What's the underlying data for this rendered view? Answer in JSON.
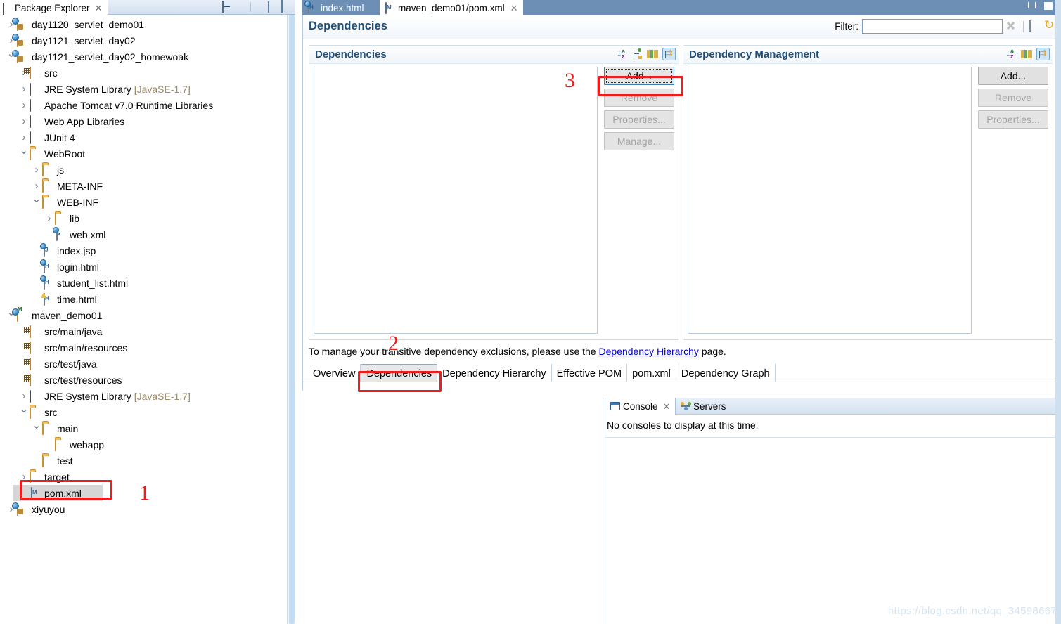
{
  "explorer": {
    "tab_label": "Package Explorer",
    "tab_icon": "grid-icon",
    "close_glyph": "✕",
    "toolbar": [
      {
        "name": "collapse-all-icon",
        "title": "Collapse All"
      },
      {
        "name": "link-with-editor-icon",
        "title": "Link with Editor"
      },
      {
        "name": "view-menu-icon",
        "title": "View Menu"
      },
      {
        "name": "minimize-icon",
        "title": "Minimize"
      },
      {
        "name": "maximize-icon",
        "title": "Maximize"
      }
    ],
    "tree": [
      {
        "label": "day1120_servlet_demo01",
        "indent": 0,
        "twist": "collapsed",
        "icon": "java-project"
      },
      {
        "label": "day1121_servlet_day02",
        "indent": 0,
        "twist": "collapsed",
        "icon": "java-project"
      },
      {
        "label": "day1121_servlet_day02_homewoak",
        "indent": 0,
        "twist": "expanded",
        "icon": "java-project"
      },
      {
        "label": "src",
        "indent": 1,
        "twist": "collapsed",
        "icon": "package"
      },
      {
        "label": "JRE System Library",
        "suffix": "[JavaSE-1.7]",
        "indent": 1,
        "twist": "collapsed",
        "icon": "library"
      },
      {
        "label": "Apache Tomcat v7.0 Runtime Libraries",
        "indent": 1,
        "twist": "collapsed",
        "icon": "library"
      },
      {
        "label": "Web App Libraries",
        "indent": 1,
        "twist": "collapsed",
        "icon": "library"
      },
      {
        "label": "JUnit 4",
        "indent": 1,
        "twist": "collapsed",
        "icon": "library"
      },
      {
        "label": "WebRoot",
        "indent": 1,
        "twist": "expanded",
        "icon": "folder"
      },
      {
        "label": "js",
        "indent": 2,
        "twist": "collapsed",
        "icon": "folder"
      },
      {
        "label": "META-INF",
        "indent": 2,
        "twist": "collapsed",
        "icon": "folder"
      },
      {
        "label": "WEB-INF",
        "indent": 2,
        "twist": "expanded",
        "icon": "folder"
      },
      {
        "label": "lib",
        "indent": 3,
        "twist": "collapsed",
        "icon": "folder"
      },
      {
        "label": "web.xml",
        "indent": 3,
        "twist": "none",
        "icon": "xml-file"
      },
      {
        "label": "index.jsp",
        "indent": 2,
        "twist": "none",
        "icon": "jsp-file"
      },
      {
        "label": "login.html",
        "indent": 2,
        "twist": "none",
        "icon": "html-file"
      },
      {
        "label": "student_list.html",
        "indent": 2,
        "twist": "none",
        "icon": "html-file"
      },
      {
        "label": "time.html",
        "indent": 2,
        "twist": "none",
        "icon": "html-file-warn"
      },
      {
        "label": "maven_demo01",
        "indent": 0,
        "twist": "expanded",
        "icon": "maven-project"
      },
      {
        "label": "src/main/java",
        "indent": 1,
        "twist": "none",
        "icon": "package"
      },
      {
        "label": "src/main/resources",
        "indent": 1,
        "twist": "none",
        "icon": "package"
      },
      {
        "label": "src/test/java",
        "indent": 1,
        "twist": "none",
        "icon": "package"
      },
      {
        "label": "src/test/resources",
        "indent": 1,
        "twist": "none",
        "icon": "package"
      },
      {
        "label": "JRE System Library",
        "suffix": "[JavaSE-1.7]",
        "indent": 1,
        "twist": "collapsed",
        "icon": "library"
      },
      {
        "label": "src",
        "indent": 1,
        "twist": "expanded",
        "icon": "folder"
      },
      {
        "label": "main",
        "indent": 2,
        "twist": "expanded",
        "icon": "folder"
      },
      {
        "label": "webapp",
        "indent": 3,
        "twist": "none",
        "icon": "folder"
      },
      {
        "label": "test",
        "indent": 2,
        "twist": "none",
        "icon": "folder"
      },
      {
        "label": "target",
        "indent": 1,
        "twist": "collapsed",
        "icon": "folder"
      },
      {
        "label": "pom.xml",
        "indent": 1,
        "twist": "none",
        "icon": "maven-file",
        "selected": true
      },
      {
        "label": "xiyuyou",
        "indent": 0,
        "twist": "collapsed",
        "icon": "java-project"
      }
    ]
  },
  "editor": {
    "tabs": [
      {
        "label": "index.html",
        "active": false,
        "icon": "html-file",
        "closable": false
      },
      {
        "label": "maven_demo01/pom.xml",
        "active": true,
        "icon": "maven-file",
        "closable": true
      }
    ],
    "close_glyph": "✕",
    "window_controls": [
      {
        "name": "minimize-icon"
      },
      {
        "name": "maximize-icon"
      }
    ]
  },
  "form": {
    "title": "Dependencies",
    "filter_label": "Filter:",
    "filter_value": "",
    "filter_placeholder": "",
    "header_icons": [
      {
        "name": "clear-filter-icon"
      },
      {
        "name": "show-advanced-tabs-icon"
      },
      {
        "name": "refresh-icon"
      }
    ],
    "sections": [
      {
        "id": "dependencies",
        "title": "Dependencies",
        "tools": [
          {
            "name": "sort-alphabetically-icon"
          },
          {
            "name": "show-hierarchy-icon"
          },
          {
            "name": "show-columns-icon"
          },
          {
            "name": "flat-layout-icon",
            "active": true
          }
        ],
        "items": [],
        "buttons": [
          {
            "label": "Add...",
            "enabled": true,
            "focused": true
          },
          {
            "label": "Remove",
            "enabled": false,
            "focused": false
          },
          {
            "label": "Properties...",
            "enabled": false,
            "focused": false
          },
          {
            "label": "Manage...",
            "enabled": false,
            "focused": false
          }
        ]
      },
      {
        "id": "dependency-management",
        "title": "Dependency Management",
        "tools": [
          {
            "name": "sort-alphabetically-icon"
          },
          {
            "name": "show-columns-icon"
          },
          {
            "name": "flat-layout-icon",
            "active": true
          }
        ],
        "items": [],
        "buttons": [
          {
            "label": "Add...",
            "enabled": true,
            "focused": false
          },
          {
            "label": "Remove",
            "enabled": false,
            "focused": false
          },
          {
            "label": "Properties...",
            "enabled": false,
            "focused": false
          }
        ]
      }
    ],
    "exclusion_note": {
      "prefix": "To manage your transitive dependency exclusions, please use the ",
      "link": "Dependency Hierarchy",
      "suffix": " page."
    },
    "tabs": [
      {
        "label": "Overview",
        "active": false
      },
      {
        "label": "Dependencies",
        "active": true
      },
      {
        "label": "Dependency Hierarchy",
        "active": false
      },
      {
        "label": "Effective POM",
        "active": false
      },
      {
        "label": "pom.xml",
        "active": false
      },
      {
        "label": "Dependency Graph",
        "active": false
      }
    ]
  },
  "console": {
    "tabs": [
      {
        "label": "Console",
        "active": true,
        "icon": "console-icon",
        "closable": true
      },
      {
        "label": "Servers",
        "active": false,
        "icon": "servers-icon",
        "closable": false
      }
    ],
    "close_glyph": "✕",
    "message": "No consoles to display at this time.",
    "tools": [
      {
        "name": "pin-console-icon"
      },
      {
        "name": "display-selected-console-icon"
      },
      {
        "name": "display-console-dropdown-icon"
      },
      {
        "name": "open-console-icon"
      },
      {
        "name": "open-console-dropdown-icon"
      },
      {
        "name": "minimize-icon"
      },
      {
        "name": "maximize-icon"
      }
    ]
  },
  "annotations": [
    {
      "number": "1",
      "target": "pom-xml-tree-item"
    },
    {
      "number": "2",
      "target": "dependencies-form-tab"
    },
    {
      "number": "3",
      "target": "add-dependency-button"
    }
  ],
  "watermark": "https://blog.csdn.net/qq_34598667",
  "colors": {
    "accent": "#1f4e79",
    "annotation": "#ee1c1c",
    "tabbar": "#6d8fb5",
    "link": "#0000cc",
    "dim_text": "#9b8a63"
  }
}
